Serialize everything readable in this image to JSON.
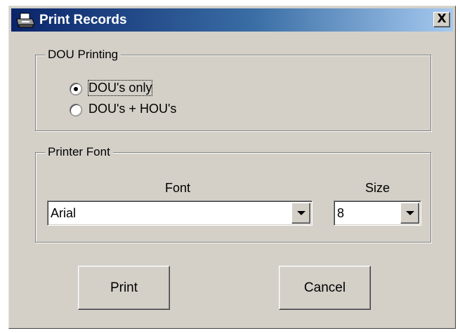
{
  "window": {
    "title": "Print Records",
    "close_label": "X"
  },
  "dou_group": {
    "legend": "DOU Printing",
    "options": [
      {
        "label": "DOU's only",
        "selected": true
      },
      {
        "label": "DOU's + HOU's",
        "selected": false
      }
    ]
  },
  "font_group": {
    "legend": "Printer Font",
    "font_label": "Font",
    "font_value": "Arial",
    "size_label": "Size",
    "size_value": "8"
  },
  "buttons": {
    "print": "Print",
    "cancel": "Cancel"
  }
}
